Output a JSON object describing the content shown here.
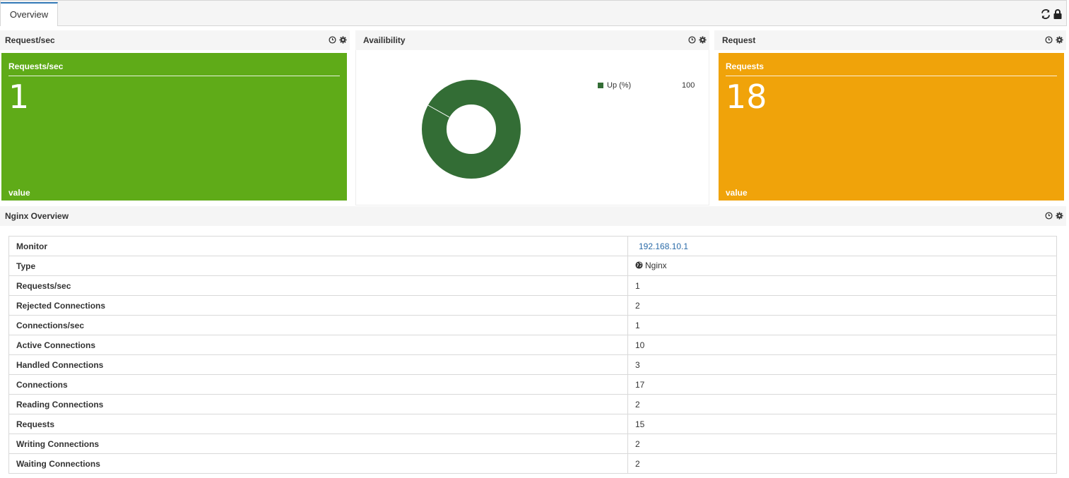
{
  "tabs": [
    {
      "label": "Overview"
    }
  ],
  "widgets": {
    "requests_sec": {
      "header": "Request/sec",
      "box_title": "Requests/sec",
      "value": "1",
      "footer": "value",
      "color": "#5fab18"
    },
    "availability": {
      "header": "Availibility",
      "legend_label": "Up (%)",
      "legend_value": "100",
      "color": "#336d35"
    },
    "request": {
      "header": "Request",
      "box_title": "Requests",
      "value": "18",
      "footer": "value",
      "color": "#f0a30a"
    },
    "nginx_overview": {
      "header": "Nginx Overview",
      "rows": [
        {
          "label": "Monitor",
          "value": "192.168.10.1"
        },
        {
          "label": "Type",
          "value": "Nginx"
        },
        {
          "label": "Requests/sec",
          "value": "1"
        },
        {
          "label": "Rejected Connections",
          "value": "2"
        },
        {
          "label": "Connections/sec",
          "value": "1"
        },
        {
          "label": "Active Connections",
          "value": "10"
        },
        {
          "label": "Handled Connections",
          "value": "3"
        },
        {
          "label": "Connections",
          "value": "17"
        },
        {
          "label": "Reading Connections",
          "value": "2"
        },
        {
          "label": "Requests",
          "value": "15"
        },
        {
          "label": "Writing Connections",
          "value": "2"
        },
        {
          "label": "Waiting Connections",
          "value": "2"
        }
      ]
    }
  },
  "icons": {
    "tabbar": [
      "refresh-icon",
      "lock-icon"
    ],
    "widget_header": [
      "clock-icon",
      "gear-icon"
    ],
    "type": "globe-icon"
  }
}
